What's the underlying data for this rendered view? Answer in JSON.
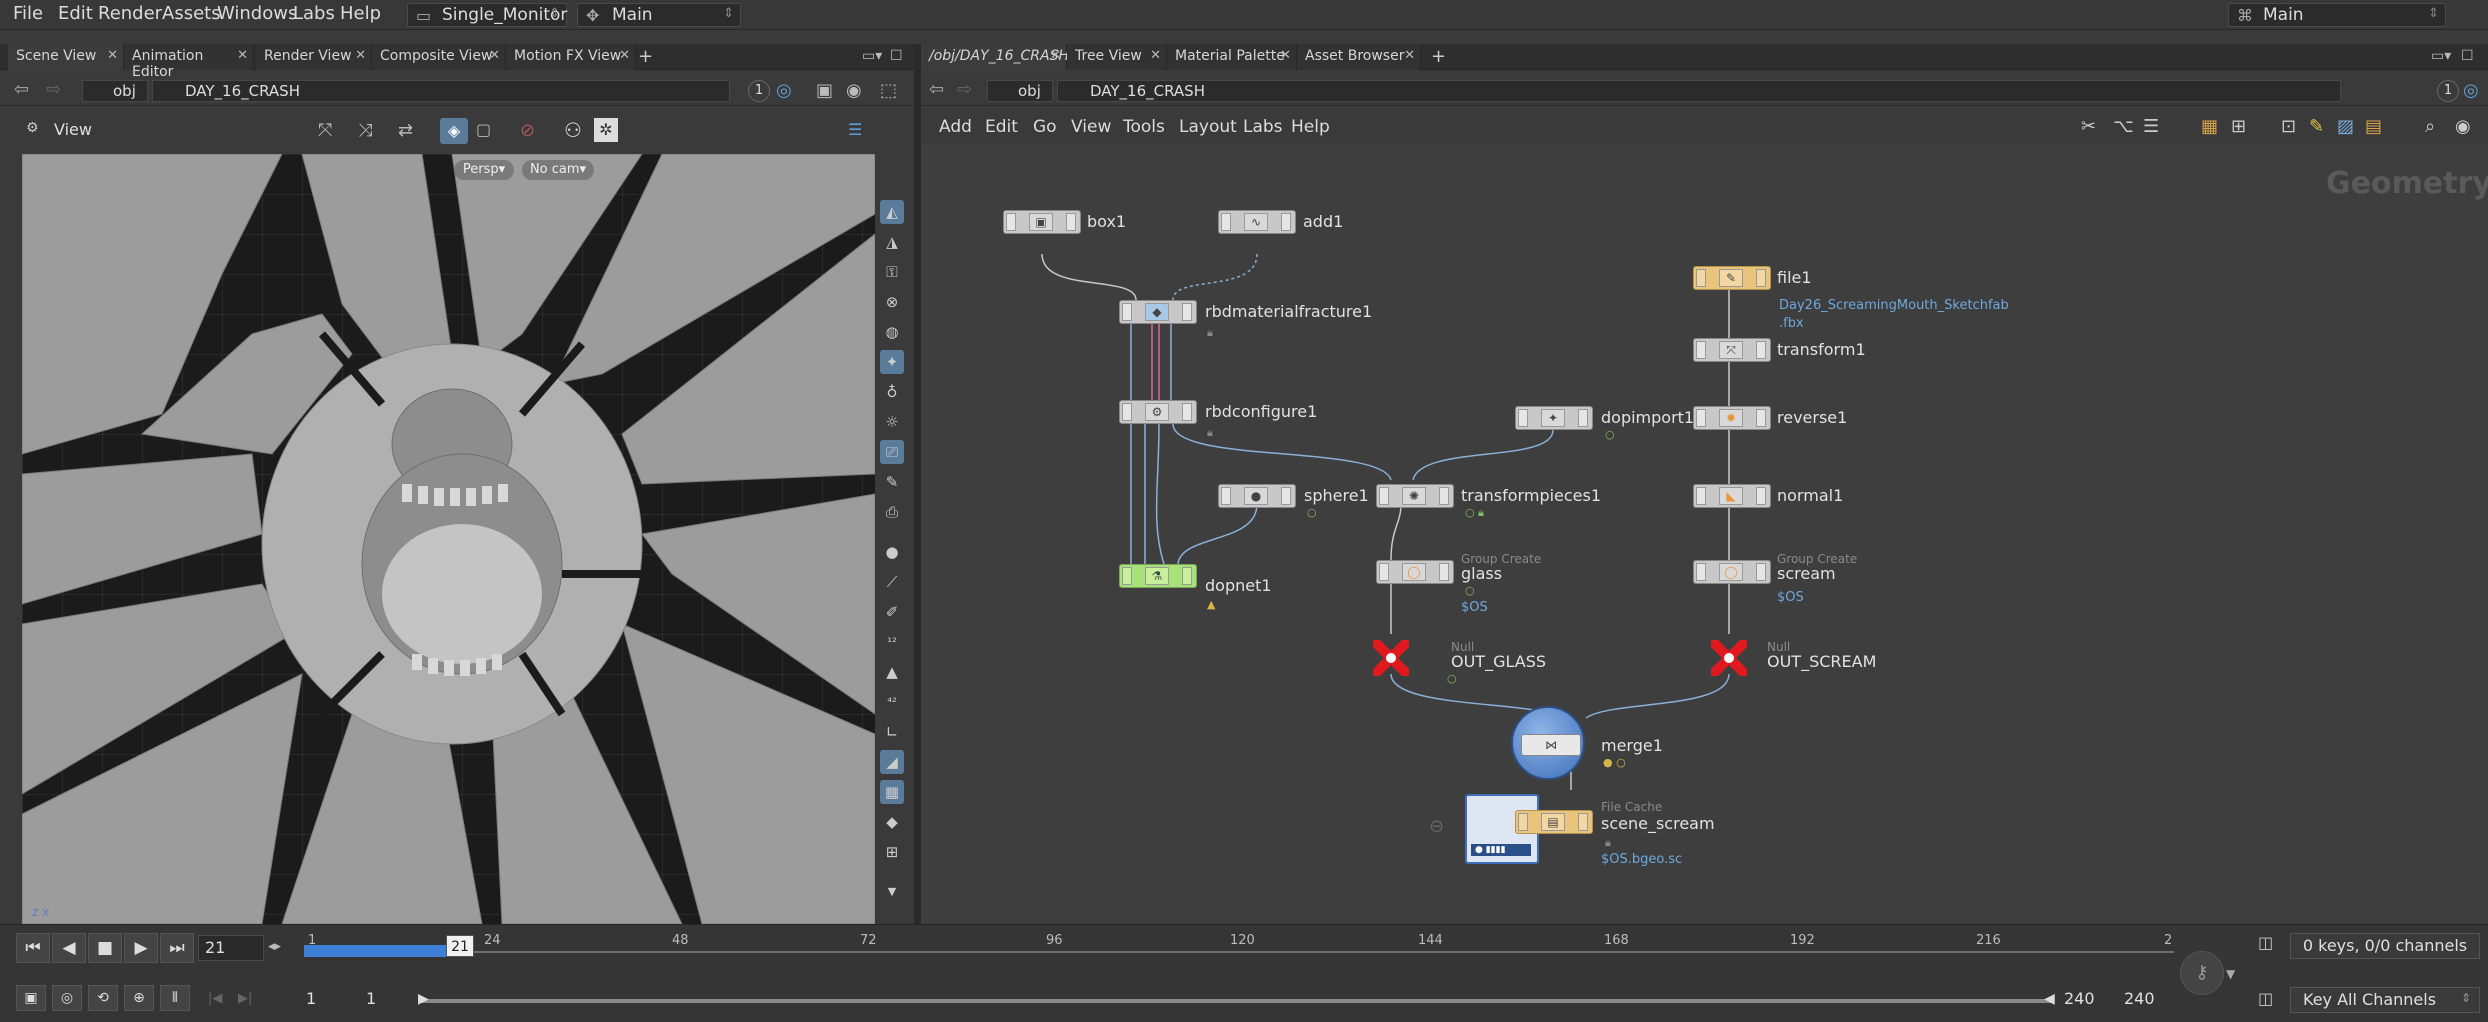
{
  "menubar": {
    "items": [
      "File",
      "Edit",
      "Render",
      "Assets",
      "Windows",
      "Labs",
      "Help"
    ],
    "desktop": "Single_Monitor",
    "workspace": "Main",
    "right_workspace": "Main"
  },
  "left_pane": {
    "tabs": [
      "Scene View",
      "Animation Editor",
      "Render View",
      "Composite View",
      "Motion FX View"
    ],
    "path": [
      "obj",
      "DAY_16_CRASH"
    ],
    "view_label": "View",
    "persp_label": "Persp",
    "cam_label": "No cam",
    "history_num": "1"
  },
  "right_pane": {
    "tabs": [
      "/obj/DAY_16_CRASH",
      "Tree View",
      "Material Palette",
      "Asset Browser"
    ],
    "path": [
      "obj",
      "DAY_16_CRASH"
    ],
    "history_num": "1",
    "menu": [
      "Add",
      "Edit",
      "Go",
      "View",
      "Tools",
      "Layout",
      "Labs",
      "Help"
    ],
    "context_label": "Geometry"
  },
  "nodes": {
    "box1": {
      "name": "box1"
    },
    "add1": {
      "name": "add1"
    },
    "rbdmaterialfracture1": {
      "name": "rbdmaterialfracture1"
    },
    "rbdconfigure1": {
      "name": "rbdconfigure1"
    },
    "dopnet1": {
      "name": "dopnet1"
    },
    "sphere1": {
      "name": "sphere1"
    },
    "transformpieces1": {
      "name": "transformpieces1"
    },
    "dopimport1": {
      "name": "dopimport1"
    },
    "glass": {
      "type": "Group Create",
      "name": "glass",
      "sub": "$OS"
    },
    "out_glass": {
      "type": "Null",
      "name": "OUT_GLASS"
    },
    "file1": {
      "name": "file1",
      "sub1": "Day26_ScreamingMouth_Sketchfab",
      "sub2": ".fbx"
    },
    "transform1": {
      "name": "transform1"
    },
    "reverse1": {
      "name": "reverse1"
    },
    "normal1": {
      "name": "normal1"
    },
    "scream": {
      "type": "Group Create",
      "name": "scream",
      "sub": "$OS"
    },
    "out_scream": {
      "type": "Null",
      "name": "OUT_SCREAM"
    },
    "merge1": {
      "name": "merge1"
    },
    "scene_scream": {
      "type": "File Cache",
      "name": "scene_scream",
      "sub": "$OS.bgeo.sc"
    }
  },
  "timeline": {
    "current_frame": "21",
    "frame_marker": "21",
    "ticks": [
      "1",
      "24",
      "48",
      "72",
      "96",
      "120",
      "144",
      "168",
      "192",
      "216",
      "2"
    ],
    "start": "1",
    "start2": "1",
    "end": "240",
    "end2": "240",
    "keys_info": "0 keys, 0/0 channels",
    "key_all": "Key All Channels"
  },
  "colors": {
    "accent_blue": "#3d7fd6",
    "null_red": "#e0191f",
    "dopnet_green": "#a8e07a",
    "file_yellow": "#e8c47c"
  }
}
